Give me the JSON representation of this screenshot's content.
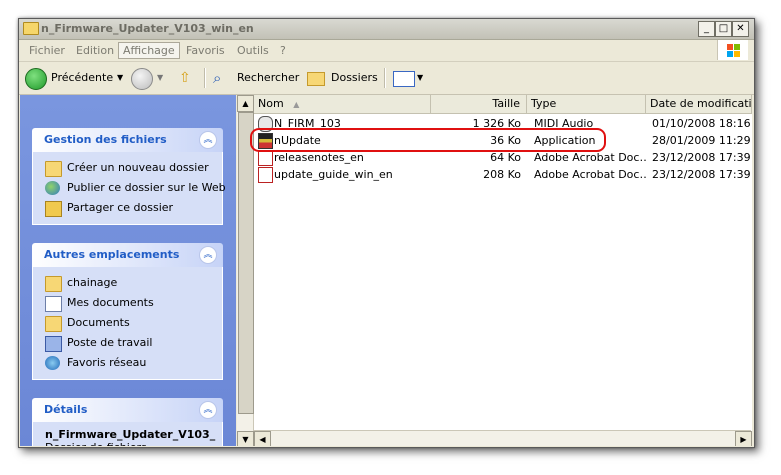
{
  "window": {
    "title": "n_Firmware_Updater_V103_win_en",
    "controls": {
      "minimize": "_",
      "maximize": "□",
      "close": "✕"
    }
  },
  "menubar": {
    "items": [
      {
        "label": "Fichier"
      },
      {
        "label": "Edition"
      },
      {
        "label": "Affichage"
      },
      {
        "label": "Favoris"
      },
      {
        "label": "Outils"
      },
      {
        "label": "?"
      }
    ]
  },
  "toolbar": {
    "back_label": "Précédente",
    "search_label": "Rechercher",
    "folders_label": "Dossiers"
  },
  "left_pane": {
    "file_tasks": {
      "title": "Gestion des fichiers",
      "items": [
        {
          "label": "Créer un nouveau dossier",
          "icon": "new-folder-icon"
        },
        {
          "label": "Publier ce dossier sur le Web",
          "icon": "globe-icon"
        },
        {
          "label": "Partager ce dossier",
          "icon": "share-icon"
        }
      ]
    },
    "other_places": {
      "title": "Autres emplacements",
      "items": [
        {
          "label": "chainage",
          "icon": "folder-icon"
        },
        {
          "label": "Mes documents",
          "icon": "my-documents-icon"
        },
        {
          "label": "Documents",
          "icon": "folder-icon"
        },
        {
          "label": "Poste de travail",
          "icon": "computer-icon"
        },
        {
          "label": "Favoris réseau",
          "icon": "network-icon"
        }
      ]
    },
    "details": {
      "title": "Détails",
      "name": "n_Firmware_Updater_V103_ ",
      "type": "Dossier de fichiers"
    }
  },
  "file_list": {
    "columns": [
      {
        "label": "Nom"
      },
      {
        "label": "Taille"
      },
      {
        "label": "Type"
      },
      {
        "label": "Date de modification"
      }
    ],
    "rows": [
      {
        "name": "N_FIRM_103",
        "size": "1 326 Ko",
        "type": "MIDI Audio",
        "date": "01/10/2008 18:16",
        "icon": "midi-icon"
      },
      {
        "name": "nUpdate",
        "size": "36 Ko",
        "type": "Application",
        "date": "28/01/2009 11:29",
        "icon": "application-icon"
      },
      {
        "name": "releasenotes_en",
        "size": "64 Ko",
        "type": "Adobe Acrobat Doc…",
        "date": "23/12/2008 17:39",
        "icon": "pdf-icon"
      },
      {
        "name": "update_guide_win_en",
        "size": "208 Ko",
        "type": "Adobe Acrobat Doc…",
        "date": "23/12/2008 17:39",
        "icon": "pdf-icon"
      }
    ]
  },
  "colors": {
    "highlight": "#e01010",
    "task_pane": "#6b87d6",
    "panel_title": "#215dc6"
  }
}
